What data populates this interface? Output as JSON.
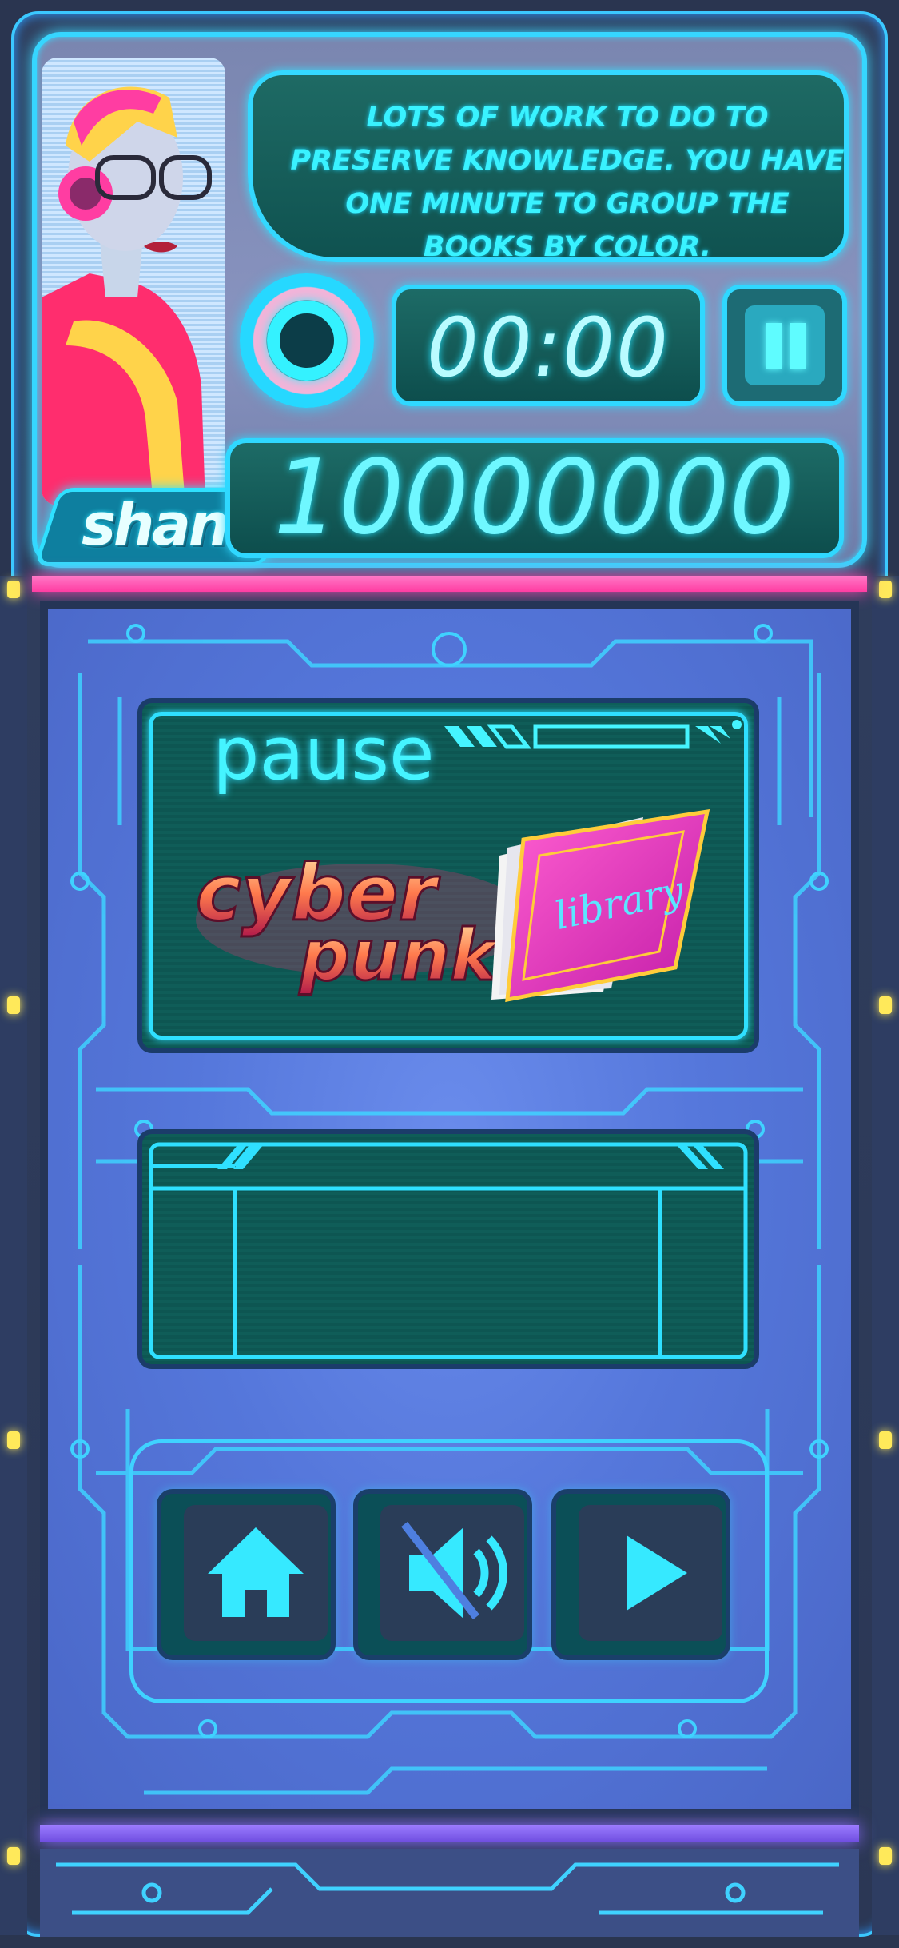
{
  "header": {
    "character_name": "shani",
    "dialog": "LOTS OF WORK TO DO TO PRESERVE KNOWLEDGE. YOU HAVE ONE MINUTE TO GROUP THE BOOKS BY COLOR.",
    "timer": "00:00",
    "score": "10000000"
  },
  "pause_panel": {
    "title": "pause",
    "logo_word_1": "cyber",
    "logo_word_2": "punk",
    "logo_book": "library"
  },
  "controls": {
    "home_icon": "home-icon",
    "sound_icon": "sound-muted-icon",
    "play_icon": "play-icon",
    "pause_icon": "pause-icon"
  },
  "colors": {
    "neon_cyan": "#2fe0ff",
    "panel_blue": "#5577db",
    "teal": "#0f5d58",
    "pink": "#ff4bb2",
    "purple": "#8c6cff"
  }
}
